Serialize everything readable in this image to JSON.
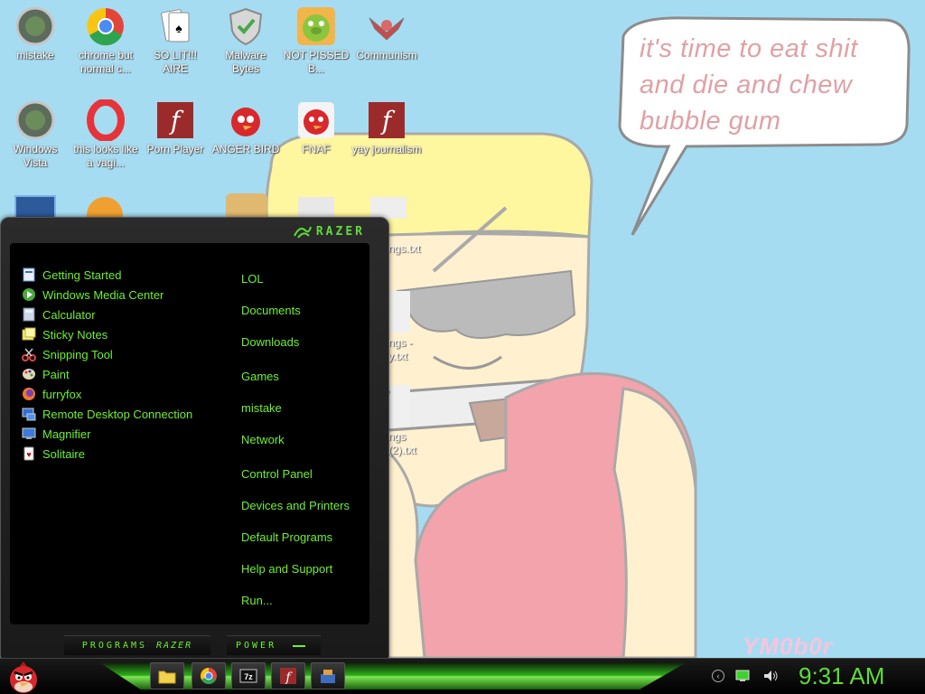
{
  "wallpaper": {
    "speech_text": "it's time to eat shit and die and chew bubble gum",
    "signature": "YM0b0r"
  },
  "desktop_icons": [
    {
      "label": "mistake",
      "icon": "vista-orb-icon"
    },
    {
      "label": "chrome but normal c...",
      "icon": "chrome-icon"
    },
    {
      "label": "SO LIT!!! AIRE",
      "icon": "cards-icon"
    },
    {
      "label": "Malware Bytes",
      "icon": "shield-icon"
    },
    {
      "label": "NOT PISSED B...",
      "icon": "green-pig-icon"
    },
    {
      "label": "Communism",
      "icon": "emblem-icon"
    },
    {
      "label": "Windows Vista",
      "icon": "vista-orb-icon"
    },
    {
      "label": "this looks like a vagi...",
      "icon": "opera-icon"
    },
    {
      "label": "Porn Player",
      "icon": "flash-icon"
    },
    {
      "label": "ANGER BIRD",
      "icon": "angry-bird-icon"
    },
    {
      "label": "FNAF",
      "icon": "angry-bird-icon"
    },
    {
      "label": "yay journalism",
      "icon": "flash-icon"
    }
  ],
  "hidden_file_labels": [
    "ngs.txt",
    "ngs - y.txt",
    "ngs (2).txt"
  ],
  "start_menu": {
    "brand": "RAZER",
    "programs": [
      {
        "label": "Getting Started",
        "icon": "document-icon"
      },
      {
        "label": "Windows Media Center",
        "icon": "media-center-icon"
      },
      {
        "label": "Calculator",
        "icon": "calculator-icon"
      },
      {
        "label": "Sticky Notes",
        "icon": "sticky-notes-icon"
      },
      {
        "label": "Snipping Tool",
        "icon": "scissors-icon"
      },
      {
        "label": "Paint",
        "icon": "palette-icon"
      },
      {
        "label": "furryfox",
        "icon": "firefox-icon"
      },
      {
        "label": "Remote Desktop Connection",
        "icon": "remote-desktop-icon"
      },
      {
        "label": "Magnifier",
        "icon": "magnifier-icon"
      },
      {
        "label": "Solitaire",
        "icon": "cards-icon"
      }
    ],
    "places": [
      "LOL",
      "Documents",
      "Downloads",
      "Games",
      "mistake",
      "Network",
      "Control Panel",
      "Devices and Printers",
      "Default Programs",
      "Help and Support",
      "Run..."
    ],
    "programs_button": "PROGRAMS",
    "programs_brand": "RAZER",
    "power_button": "POWER"
  },
  "taskbar": {
    "clock": "9:31 AM",
    "pinned": [
      "folder-icon",
      "chrome-icon",
      "7zip-icon",
      "flash-icon",
      "toolbox-icon"
    ]
  },
  "colors": {
    "accent": "#6ff02f",
    "desktop": "#a6dcf2"
  }
}
